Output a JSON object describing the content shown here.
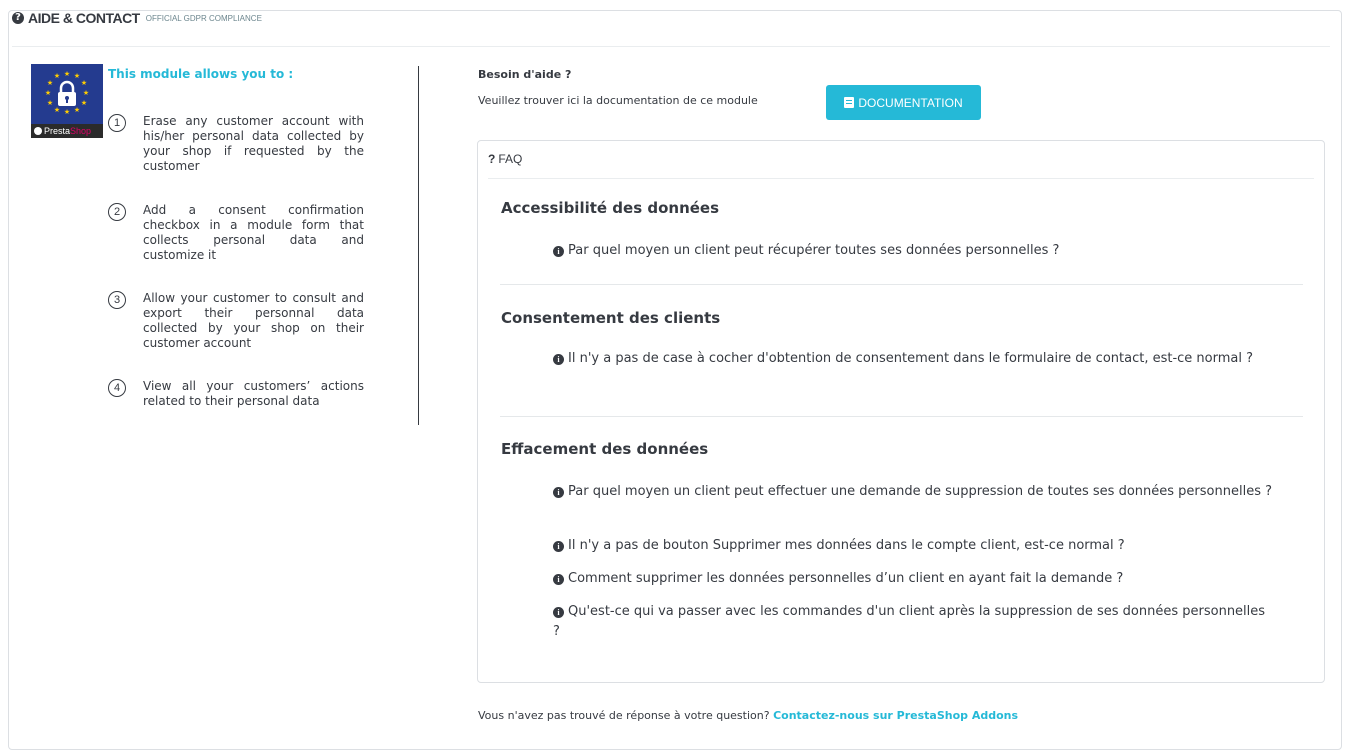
{
  "header": {
    "icon": "question-circle-icon",
    "title": "AIDE & CONTACT",
    "subtitle": "OFFICIAL GDPR COMPLIANCE"
  },
  "left": {
    "logo_brand_a": "Presta",
    "logo_brand_b": "Shop",
    "module_title": "This module allows you to :",
    "items": [
      {
        "num": "1",
        "text": "Erase any customer account with his/her personal data collected by your shop if requested by the customer"
      },
      {
        "num": "2",
        "text": "Add a consent confirmation checkbox in a module form that collects personal data and customize it"
      },
      {
        "num": "3",
        "text": "Allow your customer to consult and export their personnal data collected by your shop on their customer account"
      },
      {
        "num": "4",
        "text": "View all your customers’ actions related to their personal data"
      }
    ]
  },
  "help": {
    "title": "Besoin d'aide ?",
    "text": "Veuillez trouver ici la documentation de ce module",
    "doc_button": "DOCUMENTATION"
  },
  "faq": {
    "header_icon": "?",
    "header_label": "FAQ",
    "categories": [
      {
        "title": "Accessibilité des données",
        "questions": [
          "Par quel moyen un client peut récupérer toutes ses données personnelles ?"
        ]
      },
      {
        "title": "Consentement des clients",
        "questions": [
          "Il n'y a pas de case à cocher d'obtention de consentement dans le formulaire de contact, est-ce normal ?"
        ]
      },
      {
        "title": "Effacement des données",
        "questions": [
          "Par quel moyen un client peut effectuer une demande de suppression de toutes ses données personnelles ?",
          "Il n'y a pas de bouton Supprimer mes données dans le compte client, est-ce normal ?",
          "Comment supprimer les données personnelles d’un client en ayant fait la demande ?",
          "Qu'est-ce qui va passer avec les commandes d'un client après la suppression de ses données personnelles ?"
        ]
      }
    ]
  },
  "footer": {
    "text": "Vous n'avez pas trouvé de réponse à votre question?",
    "link": "Contactez-nous sur PrestaShop Addons"
  },
  "colors": {
    "accent": "#25b9d7",
    "text": "#363a41",
    "logo_bg": "#243b8f"
  }
}
